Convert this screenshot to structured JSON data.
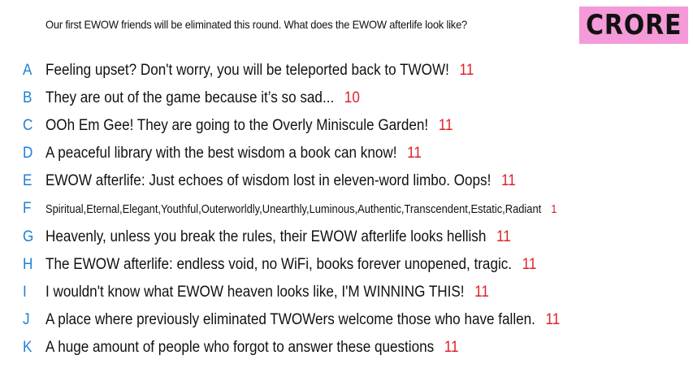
{
  "header": {
    "prompt": "Our first EWOW friends will be eliminated this round. What does the EWOW afterlife look like?",
    "badge": "CRORE"
  },
  "responses": [
    {
      "letter": "A",
      "text": "Feeling upset? Don't worry, you will be teleported back to TWOW!",
      "count": "11"
    },
    {
      "letter": "B",
      "text": "They are out of the game because it’s so sad...",
      "count": "10"
    },
    {
      "letter": "C",
      "text": "OOh Em Gee! They are going to the Overly Miniscule Garden!",
      "count": "11"
    },
    {
      "letter": "D",
      "text": "A peaceful library with the best wisdom a book can know!",
      "count": "11"
    },
    {
      "letter": "E",
      "text": "EWOW afterlife: Just echoes of wisdom lost in eleven-word limbo. Oops!",
      "count": "11"
    },
    {
      "letter": "F",
      "text": "Spiritual,Eternal,Elegant,Youthful,Outerworldly,Unearthly,Luminous,Authentic,Transcendent,Estatic,Radiant",
      "count": "1"
    },
    {
      "letter": "G",
      "text": "Heavenly, unless you break the rules, their EWOW afterlife looks hellish",
      "count": "11"
    },
    {
      "letter": "H",
      "text": "The EWOW afterlife: endless void, no WiFi, books forever unopened, tragic.",
      "count": "11"
    },
    {
      "letter": "I",
      "text": "I wouldn't know what EWOW heaven looks like, I'M WINNING THIS!",
      "count": "11"
    },
    {
      "letter": "J",
      "text": "A place where previously eliminated TWOWers welcome those who have fallen.",
      "count": "11"
    },
    {
      "letter": "K",
      "text": "A huge amount of people who forgot to answer these questions",
      "count": "11"
    }
  ],
  "colors": {
    "letter": "#1f7fd6",
    "count": "#e0202a",
    "badge_bg": "#f59ad8"
  }
}
